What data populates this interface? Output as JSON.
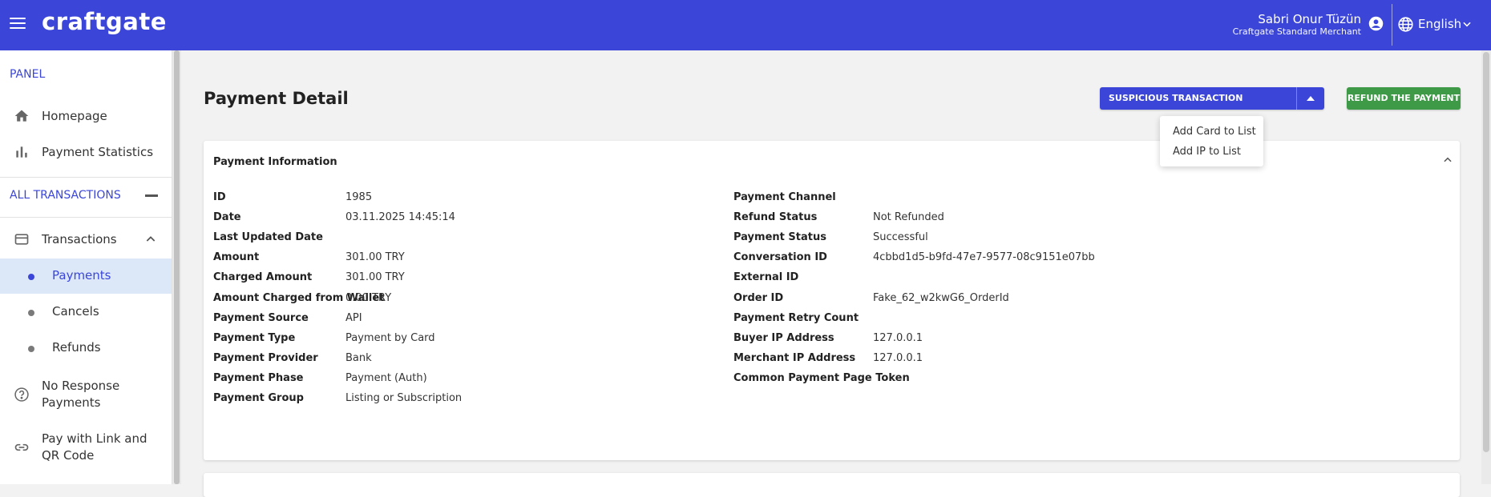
{
  "header": {
    "logo": "craftgate",
    "user_name": "Sabri Onur Tüzün",
    "user_role": "Craftgate Standard Merchant",
    "language": "English"
  },
  "sidebar": {
    "panel_title": "PANEL",
    "panel_items": [
      {
        "label": "Homepage",
        "icon": "home-icon"
      },
      {
        "label": "Payment Statistics",
        "icon": "bar-chart-icon"
      }
    ],
    "all_transactions_title": "ALL TRANSACTIONS",
    "transactions_label": "Transactions",
    "sub_items": [
      {
        "label": "Payments"
      },
      {
        "label": "Cancels"
      },
      {
        "label": "Refunds"
      }
    ],
    "no_response_label": "No Response Payments",
    "pay_link_label": "Pay with Link and QR Code"
  },
  "page": {
    "title": "Payment Detail",
    "suspicious_button": "SUSPICIOUS TRANSACTION MANAGEMENT",
    "refund_button": "REFUND THE PAYMENT",
    "dropdown": {
      "items": [
        "Add Card to List",
        "Add IP to List"
      ]
    }
  },
  "card": {
    "title": "Payment Information",
    "left_fields": [
      {
        "label": "ID",
        "value": "1985"
      },
      {
        "label": "Date",
        "value": "03.11.2025 14:45:14"
      },
      {
        "label": "Last Updated Date",
        "value": ""
      },
      {
        "label": "Amount",
        "value": "301.00 TRY"
      },
      {
        "label": "Charged Amount",
        "value": "301.00 TRY"
      },
      {
        "label": "Amount Charged from Wallet",
        "value": "0.00 TRY"
      },
      {
        "label": "Payment Source",
        "value": "API"
      },
      {
        "label": "Payment Type",
        "value": "Payment by Card"
      },
      {
        "label": "Payment Provider",
        "value": "Bank"
      },
      {
        "label": "Payment Phase",
        "value": "Payment (Auth)"
      },
      {
        "label": "Payment Group",
        "value": "Listing or Subscription"
      }
    ],
    "right_fields": [
      {
        "label": "Payment Channel",
        "value": ""
      },
      {
        "label": "Refund Status",
        "value": "Not Refunded"
      },
      {
        "label": "Payment Status",
        "value": "Successful"
      },
      {
        "label": "Conversation ID",
        "value": "4cbbd1d5-b9fd-47e7-9577-08c9151e07bb"
      },
      {
        "label": "External ID",
        "value": ""
      },
      {
        "label": "Order ID",
        "value": "Fake_62_w2kwG6_OrderId"
      },
      {
        "label": "Payment Retry Count",
        "value": ""
      },
      {
        "label": "Buyer IP Address",
        "value": "127.0.0.1"
      },
      {
        "label": "Merchant IP Address",
        "value": "127.0.0.1"
      },
      {
        "label": "Common Payment Page Token",
        "value": ""
      }
    ]
  },
  "colors": {
    "brand": "#3b46d9",
    "success": "#3e9a46",
    "active_bg": "#dce8f8"
  }
}
